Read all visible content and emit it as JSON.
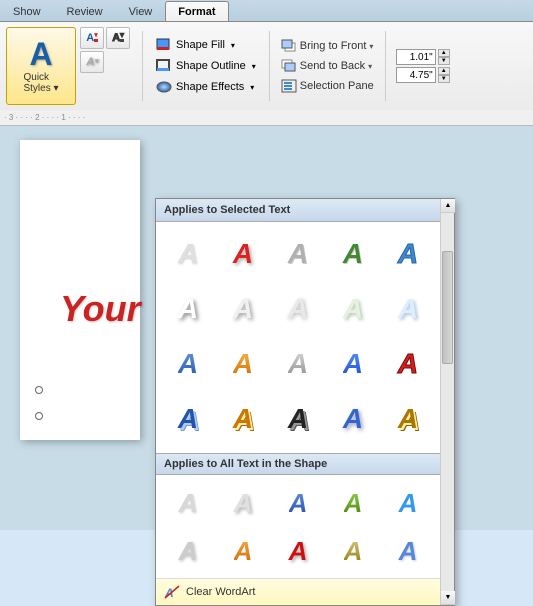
{
  "tabs": [
    {
      "label": "Show",
      "active": false
    },
    {
      "label": "Review",
      "active": false
    },
    {
      "label": "View",
      "active": false
    },
    {
      "label": "Format",
      "active": true
    }
  ],
  "ribbon": {
    "quick_styles_label": "Quick\nStyles",
    "shape_fill_label": "Shape Fill",
    "shape_outline_label": "Shape Outline",
    "shape_effects_label": "Shape Effects",
    "bring_to_front_label": "Bring to Front",
    "send_to_back_label": "Send to Back",
    "selection_pane_label": "Selection Pane",
    "size_height": "1.01\"",
    "size_width": "4.75\""
  },
  "wordart_panel": {
    "section1_header": "Applies to Selected Text",
    "section2_header": "Applies to All Text in the Shape",
    "clear_label": "Clear WordArt"
  },
  "wordart_text": "Your",
  "colors": {
    "accent": "#f90",
    "header_bg": "#c5d9e8",
    "panel_header": "#dce9f5",
    "active_tab": "#f0f0f0"
  }
}
